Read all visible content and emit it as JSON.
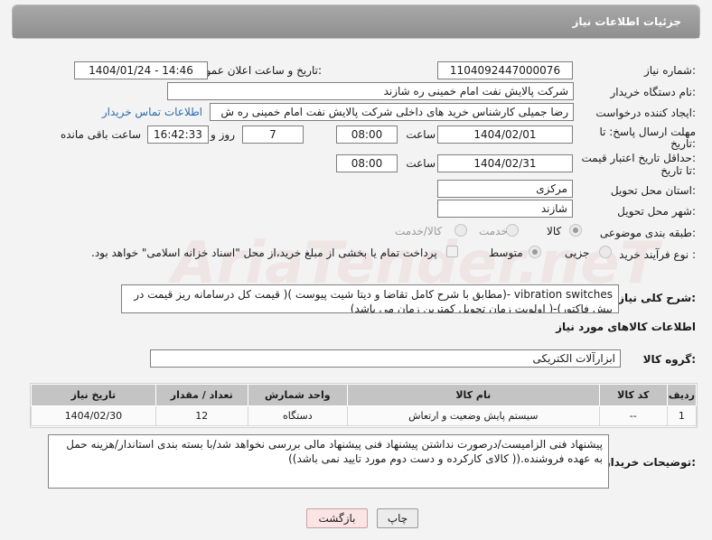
{
  "header": {
    "title": "جزئیات اطلاعات نیاز"
  },
  "fields": {
    "need_number": {
      "label": "شماره نیاز:",
      "value": "1104092447000076"
    },
    "announce_datetime": {
      "label": "تاریخ و ساعت اعلان عمومی:",
      "value": "1404/01/24 - 14:46"
    },
    "buyer_org": {
      "label": "نام دستگاه خریدار:",
      "value": "شرکت پالایش نفت امام خمینی  ره  شازند"
    },
    "creator": {
      "label": "ایجاد کننده درخواست:",
      "value": "رضا جمیلی کارشناس خرید های داخلی  شرکت پالایش نفت امام خمینی  ره  ش",
      "link": "اطلاعات تماس خریدار"
    },
    "reply_deadline": {
      "label_line1": "مهلت ارسال پاسخ: تا",
      "label_line2": "تاریخ:",
      "date": "1404/02/01",
      "time_label": "ساعت",
      "time": "08:00",
      "days": "7",
      "days_label": "روز و",
      "remaining": "16:42:33",
      "remaining_label": "ساعت باقی مانده"
    },
    "price_validity": {
      "label_line1": "حداقل تاریخ اعتبار قیمت:",
      "label_line2": "تا تاریخ:",
      "date": "1404/02/31",
      "time_label": "ساعت",
      "time": "08:00"
    },
    "province": {
      "label": "استان محل تحویل:",
      "value": "مرکزی"
    },
    "city": {
      "label": "شهر محل تحویل:",
      "value": "شازند"
    },
    "category": {
      "label": "طبقه بندی موضوعی:",
      "options": [
        "کالا",
        "خدمت",
        "کالا/خدمت"
      ],
      "selected": "کالا"
    },
    "purchase_process": {
      "label": "نوع فرآیند خرید :",
      "options": [
        "جزیی",
        "متوسط"
      ],
      "selected": "متوسط",
      "payment_note": "پرداخت تمام یا بخشی از مبلغ خرید،از محل \"اسناد خزانه اسلامی\" خواهد بود."
    }
  },
  "general_description": {
    "label": "شرح کلی نیاز:",
    "text": "vibration switches  -(مطابق با شرح کامل تقاضا و دیتا شیت پیوست )( قیمت کل درسامانه ریز قیمت در پیش فاکتور)-( اولویت زمان تحویل کمترین زمان می باشد)"
  },
  "goods_info": {
    "title": "اطلاعات کالاهای مورد نیاز",
    "group_label": "گروه کالا:",
    "group_value": "ابزارآلات الکتریکی",
    "columns": [
      "ردیف",
      "کد کالا",
      "نام کالا",
      "واحد شمارش",
      "تعداد / مقدار",
      "تاریخ نیاز"
    ],
    "rows": [
      [
        "1",
        "--",
        "سیستم پایش وضعیت و ارتعاش",
        "دستگاه",
        "12",
        "1404/02/30"
      ]
    ]
  },
  "buyer_notes": {
    "label": "توضیحات خریدار:",
    "text": "پیشنهاد فنی الزامیست/درصورت نداشتن پیشنهاد فنی پیشنهاد مالی بررسی نخواهد شد/با بسته بندی استاندار/هزینه حمل به عهده فروشنده.(( کالای کارکرده و دست دوم مورد تایید نمی باشد))"
  },
  "buttons": {
    "print": "چاپ",
    "back": "بازگشت"
  },
  "watermark": "AriaTender.neT"
}
